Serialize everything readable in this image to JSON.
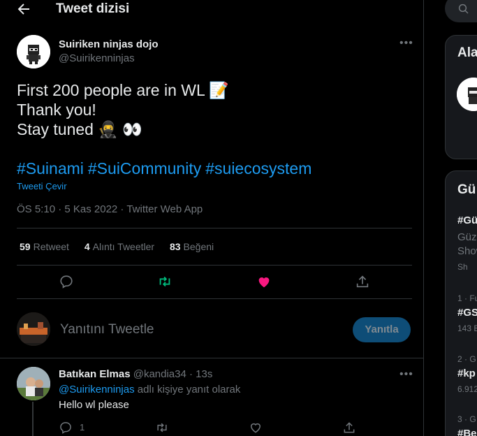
{
  "header": {
    "title": "Tweet dizisi"
  },
  "tweet": {
    "author_name": "Suiriken ninjas dojo",
    "author_handle": "@Suirikenninjas",
    "lines": [
      "First 200 people are in WL 📝",
      "Thank you!",
      "Stay tuned 🥷 👀"
    ],
    "hashtags": [
      "#Suinami",
      "#SuiCommunity",
      "#suiecosystem"
    ],
    "translate_label": "Tweeti Çevir",
    "meta": "ÖS 5:10 · 5 Kas 2022 · Twitter Web App",
    "stats": {
      "retweets": "59",
      "retweets_label": "Retweet",
      "quotes": "4",
      "quotes_label": "Alıntı Tweetler",
      "likes": "83",
      "likes_label": "Beğeni"
    }
  },
  "reply_box": {
    "placeholder": "Yanıtını Tweetle",
    "button": "Yanıtla"
  },
  "reply": {
    "name": "Batıkan Elmas",
    "handle_time": "@kandia34 · 13s",
    "replying_to": "@Suirikenninjas",
    "replying_suffix": " adlı kişiye yanıt olarak",
    "text": "Hello wl please",
    "reply_count": "1"
  },
  "sidebar": {
    "panel1_title": "Ala",
    "panel2_title": "Gü",
    "trend1_tag": "#Gü",
    "trend1_desc1": "Güze",
    "trend1_desc2": "Show",
    "trend1_promo": "Sh",
    "trend2_rank": "1 · Fu",
    "trend2_tag": "#GS",
    "trend2_count": "143 B",
    "trend3_rank": "2 · G",
    "trend3_tag": "#kp",
    "trend3_count": "6.912",
    "trend4_rank": "3 · G",
    "trend4_tag": "#Be"
  },
  "colors": {
    "accent": "#1d9bf0",
    "like": "#f91880",
    "retweet": "#00ba7c",
    "button": "#0e4d77"
  }
}
